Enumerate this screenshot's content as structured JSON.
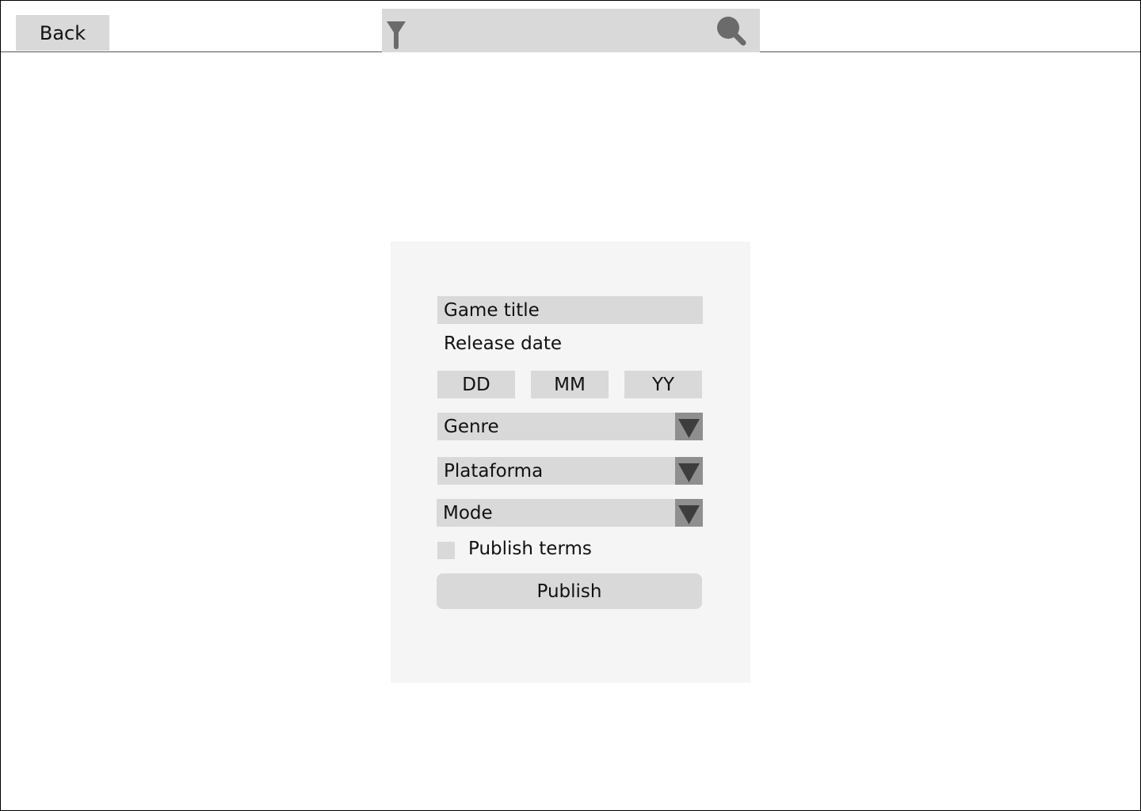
{
  "header": {
    "back_label": "Back",
    "search": {
      "value": "",
      "placeholder": ""
    },
    "icons": {
      "filter": "filter-icon",
      "search": "search-icon"
    }
  },
  "form": {
    "game_title": "Game title",
    "release_date_label": "Release date",
    "date": {
      "day": "DD",
      "month": "MM",
      "year": "YY"
    },
    "genre": "Genre",
    "platform": "Plataforma",
    "mode": "Mode",
    "terms_label": "Publish terms",
    "terms_checked": false,
    "publish_label": "Publish"
  },
  "colors": {
    "field_bg": "#d9d9d9",
    "panel_bg": "#f5f5f5",
    "chevron_bg": "#8f8f8f",
    "chevron_fg": "#3d3d3d",
    "icon_fg": "#6b6b6b"
  }
}
